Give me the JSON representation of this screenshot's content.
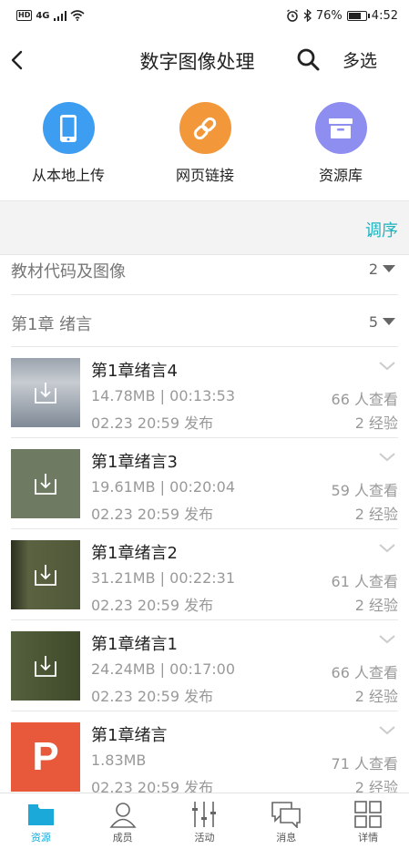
{
  "status_bar": {
    "network": "4G",
    "battery": "76%",
    "time": "4:52",
    "battery_level": 0.76
  },
  "header": {
    "title": "数字图像处理",
    "multi_select": "多选"
  },
  "uploads": [
    {
      "label": "从本地上传",
      "icon": "phone-icon",
      "color": "#3d9df0"
    },
    {
      "label": "网页链接",
      "icon": "link-icon",
      "color": "#f3983a"
    },
    {
      "label": "资源库",
      "icon": "archive-box-icon",
      "color": "#8e8ef0"
    }
  ],
  "sort_label": "调序",
  "folders": [
    {
      "name": "教材代码及图像",
      "count": "2"
    },
    {
      "name": "第1章 绪言",
      "count": "5"
    }
  ],
  "items": [
    {
      "name": "第1章绪言4",
      "meta": "14.78MB | 00:13:53",
      "views": "66 人查看",
      "date": "02.23 20:59 发布",
      "exp": "2 经验",
      "type": "video"
    },
    {
      "name": "第1章绪言3",
      "meta": "19.61MB | 00:20:04",
      "views": "59 人查看",
      "date": "02.23 20:59 发布",
      "exp": "2 经验",
      "type": "video"
    },
    {
      "name": "第1章绪言2",
      "meta": "31.21MB | 00:22:31",
      "views": "61 人查看",
      "date": "02.23 20:59 发布",
      "exp": "2 经验",
      "type": "video"
    },
    {
      "name": "第1章绪言1",
      "meta": "24.24MB | 00:17:00",
      "views": "66 人查看",
      "date": "02.23 20:59 发布",
      "exp": "2 经验",
      "type": "video"
    },
    {
      "name": "第1章绪言",
      "meta": "1.83MB",
      "views": "71 人查看",
      "date": "02.23 20:59 发布",
      "exp": "2 经验",
      "type": "ppt",
      "badge": "P"
    }
  ],
  "nav": [
    {
      "label": "资源",
      "icon": "folder-icon",
      "active": true
    },
    {
      "label": "成员",
      "icon": "person-icon"
    },
    {
      "label": "活动",
      "icon": "sliders-icon"
    },
    {
      "label": "消息",
      "icon": "chat-icon"
    },
    {
      "label": "详情",
      "icon": "grid-icon"
    }
  ],
  "colors": {
    "accent": "#1fb2bf",
    "nav_active": "#1aa9d8",
    "ppt": "#e8583a"
  }
}
